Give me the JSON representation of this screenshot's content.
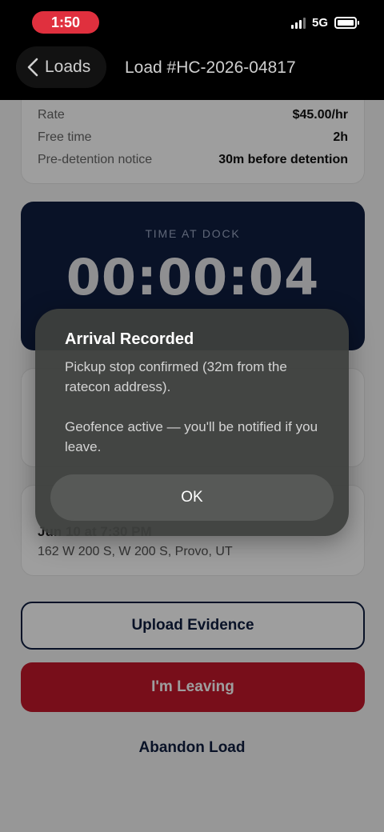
{
  "status_bar": {
    "time": "1:50",
    "network": "5G"
  },
  "nav": {
    "back_label": "Loads",
    "title": "Load #HC-2026-04817"
  },
  "rate_card": {
    "rows": [
      {
        "label": "Rate",
        "value": "$45.00/hr"
      },
      {
        "label": "Free time",
        "value": "2h"
      },
      {
        "label": "Pre-detention notice",
        "value": "30m before detention"
      }
    ]
  },
  "dock_timer": {
    "title": "TIME AT DOCK",
    "value": "00:00:04"
  },
  "stop_card": {
    "date_partial": "Jun 10 at 7:30 PM",
    "address": "162 W 200 S, W 200 S, Provo, UT"
  },
  "actions": {
    "upload_label": "Upload Evidence",
    "leaving_label": "I'm Leaving",
    "abandon_label": "Abandon Load"
  },
  "dialog": {
    "title": "Arrival Recorded",
    "message_line1": "Pickup stop confirmed (32m from the ratecon address).",
    "message_line2": "Geofence active — you'll be notified if you leave.",
    "ok_label": "OK"
  },
  "colors": {
    "navy": "#0f1d3f",
    "danger": "#c2182a",
    "status_pill": "#e0303e"
  }
}
